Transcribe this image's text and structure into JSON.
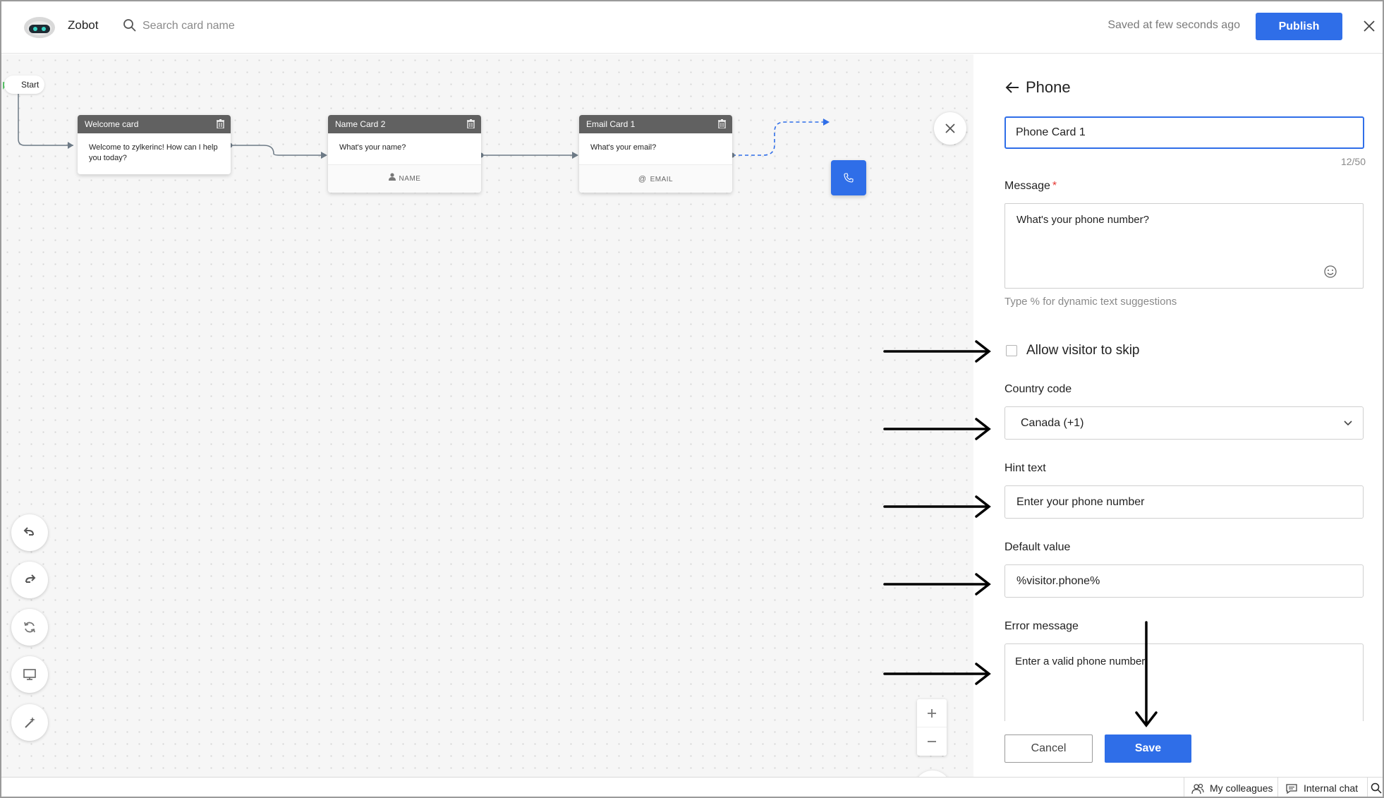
{
  "app": {
    "name": "Zobot",
    "logo_icon": "robot-logo-icon"
  },
  "search": {
    "placeholder": "Search card name"
  },
  "header": {
    "saved_status": "Saved at few seconds ago",
    "publish_label": "Publish"
  },
  "canvas": {
    "start_label": "Start",
    "cards": [
      {
        "title": "Welcome card",
        "message": "Welcome to zylkerinc! How can I help you today?",
        "field": ""
      },
      {
        "title": "Name Card 2",
        "message": "What's your name?",
        "field": "NAME",
        "field_icon": "person-icon"
      },
      {
        "title": "Email Card 1",
        "message": "What's your email?",
        "field": "EMAIL",
        "field_icon": "at-icon"
      }
    ],
    "phone_node_icon": "phone-icon",
    "tools": [
      "undo-icon",
      "redo-icon",
      "refresh-icon",
      "monitor-icon",
      "magic-wand-icon"
    ]
  },
  "panel": {
    "title": "Phone",
    "card_name": "Phone Card 1",
    "char_count": "12/50",
    "message_label": "Message",
    "message_required": "*",
    "message_value": "What's your phone number?",
    "message_hint": "Type % for dynamic text suggestions",
    "skip_label": "Allow visitor to skip",
    "skip_checked": false,
    "country_label": "Country code",
    "country_value": "Canada (+1)",
    "hint_label": "Hint text",
    "hint_value": "Enter your phone number",
    "default_label": "Default value",
    "default_value": "%visitor.phone%",
    "error_label": "Error message",
    "error_value": "Enter a valid phone number",
    "cancel_label": "Cancel",
    "save_label": "Save"
  },
  "statusbar": {
    "colleagues_label": "My colleagues",
    "chat_label": "Internal chat"
  },
  "colors": {
    "accent": "#2f6ee8",
    "card_header": "#616161",
    "required": "#e53935"
  }
}
